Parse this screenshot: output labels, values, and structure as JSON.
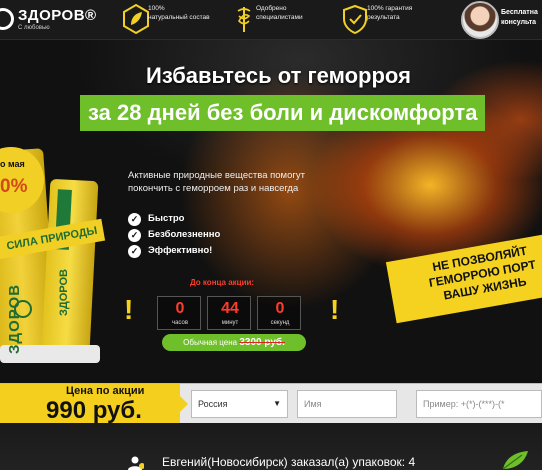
{
  "header": {
    "logo": {
      "name": "ЗДОРОВ®",
      "sub": "С любовью"
    },
    "features": [
      {
        "icon": "leaf-icon",
        "line1": "100%",
        "line2": "натуральный состав"
      },
      {
        "icon": "caduceus-icon",
        "line1": "Одобрено",
        "line2": "специалистами"
      },
      {
        "icon": "shield-icon",
        "line1": "100% гарантия",
        "line2": "результата"
      }
    ],
    "consult": {
      "line1": "Бесплатна",
      "line2": "консульта"
    }
  },
  "hero": {
    "title": "Избавьтесь от геморроя",
    "subtitle": "за 28 дней без боли и дискомфорта",
    "description": "Активные природные вещества помогут покончить с геморроем раз и навсегда",
    "benefits": [
      "Быстро",
      "Безболезненно",
      "Эффективно!"
    ],
    "slogan_line1": "НЕ ПОЗВОЛЯЙТ",
    "slogan_line2": "ГЕМОРРОЮ ПОРТ",
    "slogan_line3": "ВАШУ ЖИЗНЬ"
  },
  "product": {
    "badge_date": "о мая",
    "badge_pct": "0%",
    "ribbon": "СИЛА ПРИРОДЫ",
    "brand": "ЗДОРОВ",
    "brand2": "ЗДОРОВ"
  },
  "timer": {
    "label": "До конца акции:",
    "hours": "0",
    "hours_unit": "часов",
    "minutes": "44",
    "minutes_unit": "минут",
    "seconds": "0",
    "seconds_unit": "секунд"
  },
  "pricing": {
    "old_label": "Обычная цена",
    "old_price": "3300 руб.",
    "promo_label": "Цена по акции",
    "promo_price": "990 руб."
  },
  "form": {
    "country": "Россия",
    "name_placeholder": "Имя",
    "phone_placeholder": "Пример: +(*)-(***)-(*"
  },
  "notification": {
    "text": "Евгений(Новосибирск) заказал(а) упаковок: 4"
  }
}
